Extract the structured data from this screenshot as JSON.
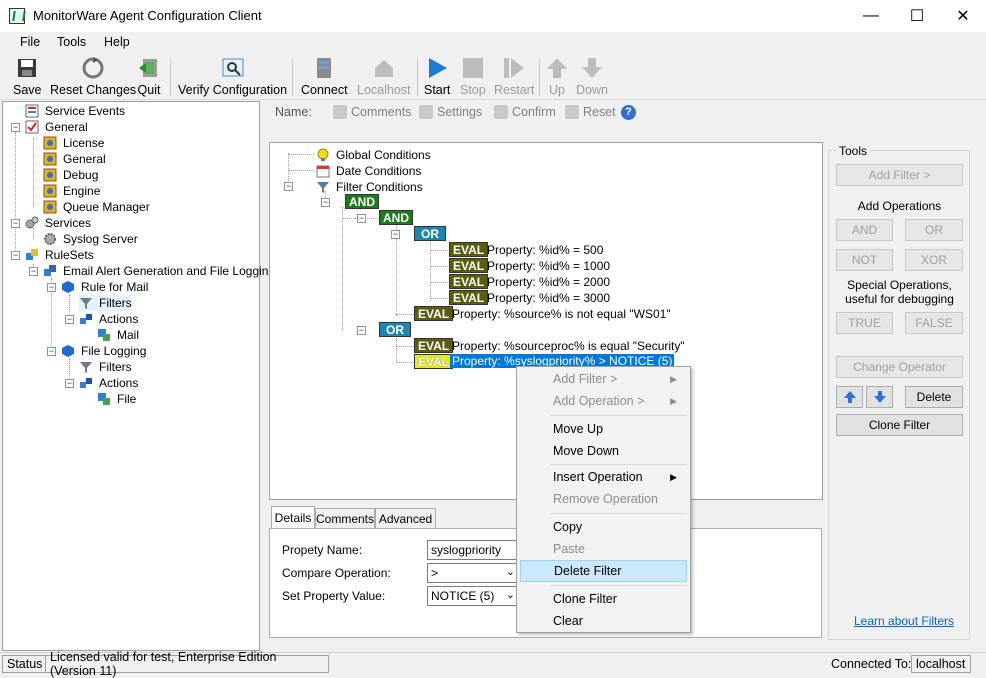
{
  "window": {
    "title": "MonitorWare Agent Configuration Client",
    "min": "—",
    "max": "☐",
    "close": "✕"
  },
  "menu": [
    "File",
    "Tools",
    "Help"
  ],
  "toolbar": {
    "save": "Save",
    "reset_changes": "Reset Changes",
    "quit": "Quit",
    "verify": "Verify Configuration",
    "connect": "Connect",
    "localhost": "Localhost",
    "start": "Start",
    "stop": "Stop",
    "restart": "Restart",
    "up": "Up",
    "down": "Down"
  },
  "tree": {
    "service_events": "Service Events",
    "general": "General",
    "license": "License",
    "general_child": "General",
    "debug": "Debug",
    "engine": "Engine",
    "queue_manager": "Queue Manager",
    "services": "Services",
    "syslog_server": "Syslog Server",
    "rulesets": "RuleSets",
    "email_alert": "Email Alert Generation and File Logging",
    "rule_for_mail": "Rule for Mail",
    "filters1": "Filters",
    "actions1": "Actions",
    "mail": "Mail",
    "file_logging": "File Logging",
    "filters2": "Filters",
    "actions2": "Actions",
    "file": "File"
  },
  "subtoolbar": {
    "name_label": "Name:",
    "comments": "Comments",
    "settings": "Settings",
    "confirm": "Confirm",
    "reset": "Reset"
  },
  "filter_tree": {
    "global_conditions": "Global Conditions",
    "date_conditions": "Date Conditions",
    "filter_conditions": "Filter Conditions",
    "and_label": "AND",
    "or_label": "OR",
    "eval_label": "EVAL",
    "eval1": "Property: %id% = 500",
    "eval2": "Property: %id% = 1000",
    "eval3": "Property: %id% = 2000",
    "eval4": "Property: %id% = 3000",
    "eval5": "Property: %source% is not equal \"WS01\"",
    "eval6": "Property: %sourceproc% is equal \"Security\"",
    "eval7": "Property: %syslogpriority% > NOTICE (5)"
  },
  "tabs": {
    "details": "Details",
    "comments": "Comments",
    "advanced": "Advanced"
  },
  "details": {
    "property_name_label": "Propety Name:",
    "property_name_value": "syslogpriority",
    "compare_label": "Compare Operation:",
    "compare_value": ">",
    "set_value_label": "Set Property Value:",
    "set_value_value": "NOTICE (5)"
  },
  "tools": {
    "title": "Tools",
    "add_filter": "Add Filter >",
    "add_operations": "Add Operations",
    "and": "AND",
    "or": "OR",
    "not": "NOT",
    "xor": "XOR",
    "special_ops": "Special Operations,\nuseful for debugging",
    "true": "TRUE",
    "false": "FALSE",
    "change_operator": "Change Operator",
    "delete": "Delete",
    "clone_filter": "Clone Filter",
    "learn_link": "Learn about Filters"
  },
  "context_menu": {
    "add_filter": "Add Filter >",
    "add_operation": "Add Operation >",
    "move_up": "Move Up",
    "move_down": "Move Down",
    "insert_operation": "Insert Operation",
    "remove_operation": "Remove Operation",
    "copy": "Copy",
    "paste": "Paste",
    "delete_filter": "Delete Filter",
    "clone_filter": "Clone Filter",
    "clear": "Clear"
  },
  "status": {
    "status": "Status",
    "license": "Licensed valid for test, Enterprise Edition (Version 11)",
    "connected_to": "Connected To:",
    "host": "localhost"
  },
  "colors": {
    "and": "#1d7a1d",
    "or": "#1d86b0",
    "eval": "#5c5c10",
    "selection": "#0078d7",
    "menu_hover": "#cce8ff",
    "link": "#0066cc"
  }
}
